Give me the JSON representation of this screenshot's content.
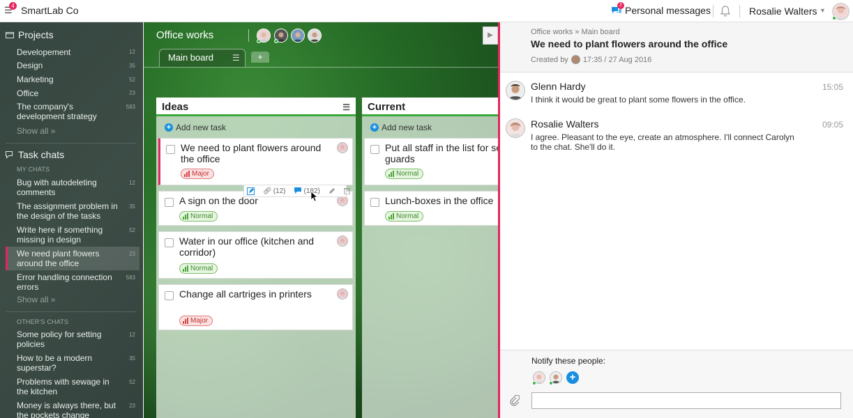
{
  "header": {
    "app_name": "SmartLab Co",
    "logo_badge": "4",
    "messages_badge": "2",
    "messages_label": "Personal messages",
    "user_name": "Rosalie Walters",
    "icons": [
      "menu-icon",
      "chat-icon",
      "bell-icon",
      "chevron-down-icon",
      "avatar"
    ]
  },
  "sidebar": {
    "projects_title": "Projects",
    "projects": [
      {
        "label": "Developement",
        "count": "12"
      },
      {
        "label": "Design",
        "count": "35"
      },
      {
        "label": "Marketing",
        "count": "52"
      },
      {
        "label": "Office",
        "count": "23"
      },
      {
        "label": "The company's development strategy",
        "count": "583"
      }
    ],
    "projects_show_all": "Show all »",
    "chats_title": "Task chats",
    "my_chats_label": "MY CHATS",
    "my_chats": [
      {
        "label": "Bug with autodeleting comments",
        "count": "12"
      },
      {
        "label": "The assignment problem in the design of the tasks",
        "count": "35"
      },
      {
        "label": "Write here if something missing in design",
        "count": "52"
      },
      {
        "label": "We need plant flowers around the office",
        "count": "23"
      },
      {
        "label": "Error handling connection errors",
        "count": "583"
      }
    ],
    "my_chats_show_all": "Show all »",
    "other_chats_label": "OTHER'S CHATS",
    "other_chats": [
      {
        "label": "Some policy for setting policies",
        "count": "12"
      },
      {
        "label": "How to be a modern superstar?",
        "count": "35"
      },
      {
        "label": "Problems with sewage in the kitchen",
        "count": "52"
      },
      {
        "label": "Money is always there, but the pockets change",
        "count": "23"
      }
    ]
  },
  "board": {
    "title": "Office works",
    "tab_label": "Main board",
    "tab_add": "+",
    "collapse_icon": "▶",
    "columns": [
      {
        "title": "Ideas",
        "add_task": "Add new task",
        "tasks": [
          {
            "title": "We need to plant flowers around the office",
            "priority": "Major"
          },
          {
            "title": "A sign on the door",
            "priority": "Normal"
          },
          {
            "title": "Water in our office (kitchen and corridor)",
            "priority": "Normal"
          },
          {
            "title": "Change all cartriges in printers",
            "priority": "Major"
          }
        ]
      },
      {
        "title": "Current",
        "add_task": "Add new task",
        "tasks": [
          {
            "title": "Put all staff in the list for security guards",
            "priority": "Normal"
          },
          {
            "title": "Lunch-boxes in the office",
            "priority": "Normal"
          }
        ]
      }
    ],
    "toolbar": {
      "links": "(12)",
      "comments": "(182)"
    }
  },
  "panel": {
    "breadcrumb": "Office works » Main board",
    "title": "We need to plant flowers around the office",
    "created_by": "Created by",
    "created_at": "17:35 / 27 Aug 2016",
    "messages": [
      {
        "author": "Glenn Hardy",
        "time": "15:05",
        "text": "I think it would be great to plant some flowers in the office."
      },
      {
        "author": "Rosalie Walters",
        "time": "09:05",
        "text": "I agree. Pleasant to the eye, create an atmosphere. I'll connect Carolyn to the chat. She'll do it."
      }
    ],
    "notify_label": "Notify these people:",
    "input_value": ""
  },
  "colors": {
    "accent": "#e6245e",
    "blue": "#1a8fe0",
    "green": "#3aa83a",
    "major": "#d64545",
    "normal": "#4da638"
  }
}
